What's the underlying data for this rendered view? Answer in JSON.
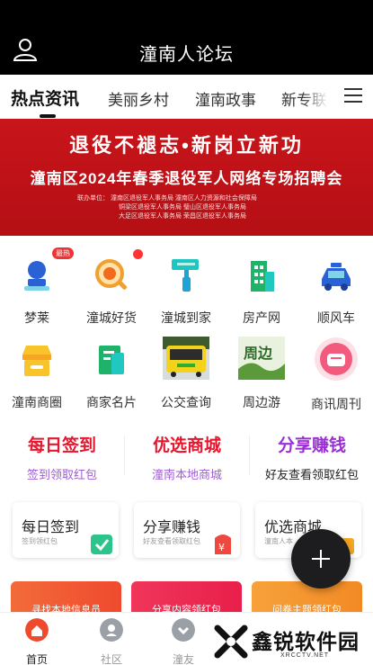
{
  "header": {
    "title": "潼南人论坛",
    "user_icon": "user-icon"
  },
  "tabs": [
    {
      "label": "热点资讯",
      "active": true
    },
    {
      "label": "美丽乡村"
    },
    {
      "label": "潼南政事"
    },
    {
      "label": "新专联"
    }
  ],
  "banner": {
    "line1": "退役不褪志•新岗立新功",
    "line2": "潼南区2024年春季退役军人网络专场招聘会",
    "organizers": [
      "联办单位：  潼南区退役军人事务局        潼南区人力资源和社会保障局",
      "铜梁区退役军人事务局        璧山区退役军人事务局",
      "大足区退役军人事务局        荣昌区退役军人事务局"
    ]
  },
  "grid": [
    {
      "label": "梦莱",
      "icon": "stamp-icon"
    },
    {
      "label": "潼城好货",
      "icon": "magnifier-icon"
    },
    {
      "label": "潼城到家",
      "icon": "paint-roller-icon"
    },
    {
      "label": "房产网",
      "icon": "building-icon"
    },
    {
      "label": "顺风车",
      "icon": "taxi-icon"
    },
    {
      "label": "潼南商圈",
      "icon": "shop-icon"
    },
    {
      "label": "商家名片",
      "icon": "card-icon"
    },
    {
      "label": "公交查询",
      "icon": "bus-photo"
    },
    {
      "label": "周边游",
      "icon": "travel-photo"
    },
    {
      "label": "商讯周刊",
      "icon": "weekly-icon"
    }
  ],
  "hot_badge": "最热",
  "promos": [
    {
      "title": "每日签到",
      "sub": "签到领取红包",
      "title_color": "#e5162d",
      "sub_color": "#a05cd6"
    },
    {
      "title": "优选商城",
      "sub": "潼南本地商城",
      "title_color": "#e5162d",
      "sub_color": "#a05cd6"
    },
    {
      "title": "分享赚钱",
      "sub": "好友查看领取红包",
      "title_color": "#9a2fd4",
      "sub_color": "#222222"
    }
  ],
  "cards": [
    {
      "title": "每日签到",
      "sub": "签到领红包",
      "icon": "checkin-icon"
    },
    {
      "title": "分享赚钱",
      "sub": "好友查看领取红包",
      "icon": "red-packet-icon"
    },
    {
      "title": "优选商城",
      "sub": "潼南人本",
      "icon": "bag-icon"
    }
  ],
  "strips": [
    {
      "label": "寻找本地信息员"
    },
    {
      "label": "分享内容领红包"
    },
    {
      "label": "问卷主题领红包"
    }
  ],
  "bottom_nav": [
    {
      "label": "首页",
      "active": true
    },
    {
      "label": "社区"
    },
    {
      "label": "潼友"
    }
  ],
  "watermark": {
    "text": "鑫锐软件园",
    "url": "XRCCTV.NET"
  },
  "colors": {
    "banner_red": "#c8151b",
    "accent_red": "#e5162d",
    "accent_purple": "#9a2fd4"
  }
}
